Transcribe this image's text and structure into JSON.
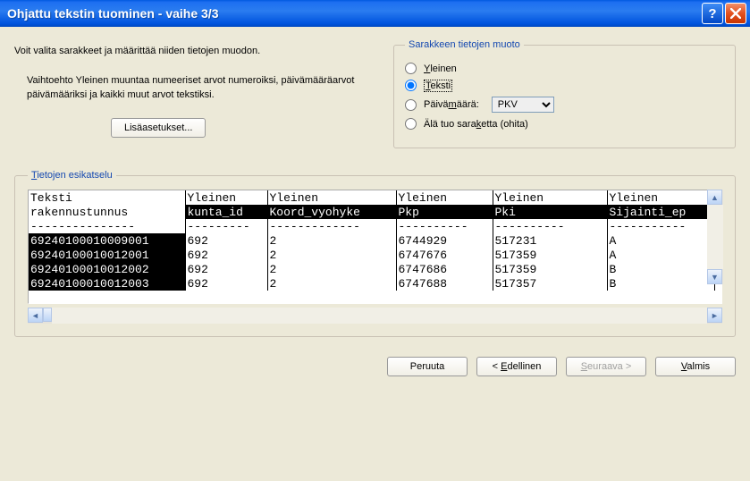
{
  "title": "Ohjattu tekstin tuominen - vaihe 3/3",
  "instruction": "Voit valita sarakkeet ja määrittää niiden tietojen muodon.",
  "description": "Vaihtoehto Yleinen muuntaa numeeriset arvot numeroiksi, päivämääräarvot päivämääriksi ja kaikki muut arvot tekstiksi.",
  "advanced_btn": "Lisäasetukset...",
  "format_group": {
    "legend": "Sarakkeen tietojen muoto",
    "general": "Yleinen",
    "text": "Teksti",
    "date": "Päivämäärä:",
    "date_value": "PKV",
    "skip": "Älä tuo saraketta (ohita)"
  },
  "preview_legend": "Tietojen esikatselu",
  "columns": {
    "types": [
      "Teksti",
      "Yleinen",
      "Yleinen",
      "Yleinen",
      "Yleinen",
      "Yleinen"
    ],
    "names": [
      "rakennustunnus",
      "kunta_id",
      "Koord_vyohyke",
      "Pkp",
      "Pki",
      "Sijainti_ep"
    ]
  },
  "rows": [
    [
      "6924010001000900",
      "692",
      "2",
      "6744929",
      "517231",
      "A"
    ],
    [
      "6924010001001200",
      "692",
      "2",
      "6747676",
      "517359",
      "A"
    ],
    [
      "6924010001001200",
      "692",
      "2",
      "6747686",
      "517359",
      "B"
    ],
    [
      "6924010001001200",
      "692",
      "2",
      "6747688",
      "517357",
      "B"
    ]
  ],
  "row_suffix": [
    "1",
    "1",
    "2",
    "3"
  ],
  "buttons": {
    "cancel": "Peruuta",
    "back": "< Edellinen",
    "next": "Seuraava >",
    "finish": "Valmis"
  }
}
